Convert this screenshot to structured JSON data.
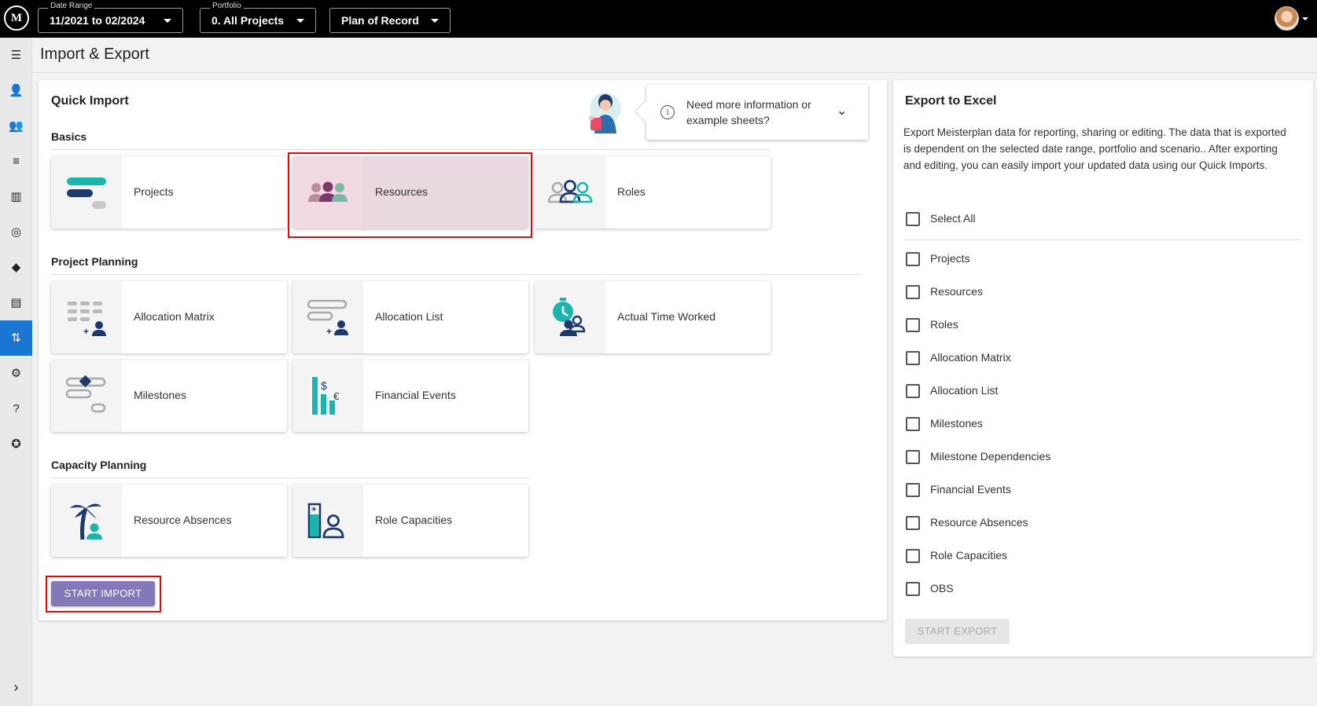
{
  "topbar": {
    "logo_text": "M",
    "date_range": {
      "label": "Date Range",
      "value": "11/2021 to 02/2024"
    },
    "portfolio": {
      "label": "Portfolio",
      "value": "0. All Projects"
    },
    "scenario": {
      "value": "Plan of Record"
    }
  },
  "sidebar": {
    "items": [
      {
        "name": "menu",
        "glyph": "☰"
      },
      {
        "name": "resources",
        "glyph": "👤"
      },
      {
        "name": "teams",
        "glyph": "👥"
      },
      {
        "name": "list",
        "glyph": "≡"
      },
      {
        "name": "columns",
        "glyph": "▥"
      },
      {
        "name": "target",
        "glyph": "◎"
      },
      {
        "name": "routing",
        "glyph": "◆"
      },
      {
        "name": "document",
        "glyph": "▤"
      },
      {
        "name": "import-export",
        "glyph": "⇅"
      },
      {
        "name": "settings",
        "glyph": "⚙"
      },
      {
        "name": "help",
        "glyph": "?"
      },
      {
        "name": "explore",
        "glyph": "✪"
      }
    ],
    "expand_glyph": "›"
  },
  "page": {
    "title": "Import & Export"
  },
  "quick_import": {
    "title": "Quick Import",
    "tip_text": "Need more information or example sheets?",
    "sections": {
      "basics": "Basics",
      "project_planning": "Project Planning",
      "capacity_planning": "Capacity Planning"
    },
    "tiles": {
      "projects": "Projects",
      "resources": "Resources",
      "roles": "Roles",
      "allocation_matrix": "Allocation Matrix",
      "allocation_list": "Allocation List",
      "actual_time_worked": "Actual Time Worked",
      "milestones": "Milestones",
      "financial_events": "Financial Events",
      "resource_absences": "Resource Absences",
      "role_capacities": "Role Capacities"
    },
    "selected_tile": "Resources",
    "start_import": "START IMPORT"
  },
  "export": {
    "title": "Export to Excel",
    "description": "Export Meisterplan data for reporting, sharing or editing. The data that is exported is dependent on the selected date range, portfolio and scenario.. After exporting and editing, you can easily import your updated data using our Quick Imports.",
    "select_all": "Select All",
    "options": [
      "Projects",
      "Resources",
      "Roles",
      "Allocation Matrix",
      "Allocation List",
      "Milestones",
      "Milestone Dependencies",
      "Financial Events",
      "Resource Absences",
      "Role Capacities",
      "OBS"
    ],
    "start_export": "START EXPORT"
  },
  "colors": {
    "accent": "#8478b8",
    "nav_active": "#1976d2",
    "teal": "#1cb5ac",
    "navy": "#1d3a6e",
    "highlight": "#e00000"
  }
}
